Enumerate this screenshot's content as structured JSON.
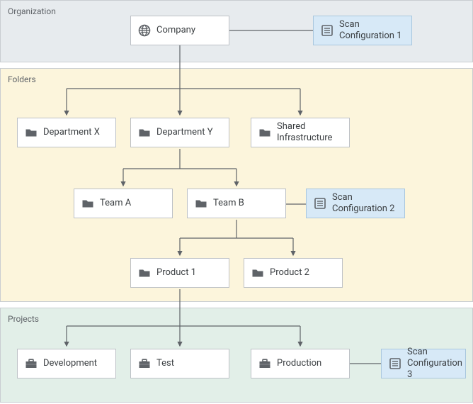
{
  "sections": {
    "organization": "Organization",
    "folders": "Folders",
    "projects": "Projects"
  },
  "nodes": {
    "company": "Company",
    "scan1": "Scan\nConfiguration 1",
    "deptX": "Department X",
    "deptY": "Department Y",
    "shared": "Shared\nInfrastructure",
    "teamA": "Team A",
    "teamB": "Team B",
    "scan2": "Scan\nConfiguration 2",
    "prod1": "Product 1",
    "prod2": "Product 2",
    "dev": "Development",
    "test": "Test",
    "production": "Production",
    "scan3": "Scan\nConfiguration 3"
  },
  "chart_data": {
    "type": "tree",
    "title": "",
    "levels": [
      {
        "section": "Organization",
        "items": [
          "Company"
        ]
      },
      {
        "section": "Folders",
        "items": [
          "Department X",
          "Department Y",
          "Shared Infrastructure"
        ]
      },
      {
        "section": "Folders",
        "items": [
          "Team A",
          "Team B"
        ]
      },
      {
        "section": "Folders",
        "items": [
          "Product 1",
          "Product 2"
        ]
      },
      {
        "section": "Projects",
        "items": [
          "Development",
          "Test",
          "Production"
        ]
      }
    ],
    "edges": [
      [
        "Company",
        "Department X"
      ],
      [
        "Company",
        "Department Y"
      ],
      [
        "Company",
        "Shared Infrastructure"
      ],
      [
        "Department Y",
        "Team A"
      ],
      [
        "Department Y",
        "Team B"
      ],
      [
        "Team B",
        "Product 1"
      ],
      [
        "Team B",
        "Product 2"
      ],
      [
        "Product 1",
        "Development"
      ],
      [
        "Product 1",
        "Test"
      ],
      [
        "Product 1",
        "Production"
      ]
    ],
    "attachments": [
      {
        "to": "Company",
        "item": "Scan Configuration 1"
      },
      {
        "to": "Team B",
        "item": "Scan Configuration 2"
      },
      {
        "to": "Production",
        "item": "Scan Configuration 3"
      }
    ]
  }
}
